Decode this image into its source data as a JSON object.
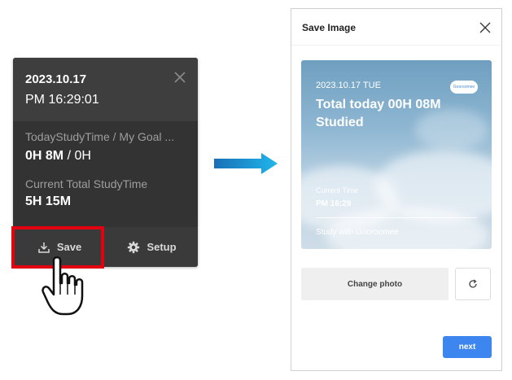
{
  "widget": {
    "date": "2023.10.17",
    "time": "PM 16:29:01",
    "today_label": "TodayStudyTime / My Goal ...",
    "today_value": "0H 8M",
    "goal_value": "0H",
    "goal_sep": " / ",
    "total_label": "Current Total StudyTime",
    "total_value": "5H 15M",
    "save_label": "Save",
    "setup_label": "Setup"
  },
  "dialog": {
    "title": "Save Image",
    "card": {
      "date": "2023.10.17 TUE",
      "headline": "Total today 00H 08M Studied",
      "logo": "Gooroomee",
      "current_time_label": "Current Time",
      "current_time": "PM 16:29",
      "footer": "Study with Gooroomee"
    },
    "change_photo_label": "Change photo",
    "next_label": "next"
  },
  "colors": {
    "highlight": "#e3000f",
    "accent": "#3d86f0",
    "arrow": "#1f9ae0"
  },
  "icons": [
    "close-icon",
    "download-icon",
    "gear-icon",
    "pointer-hand-icon",
    "refresh-icon",
    "right-arrow-icon"
  ]
}
